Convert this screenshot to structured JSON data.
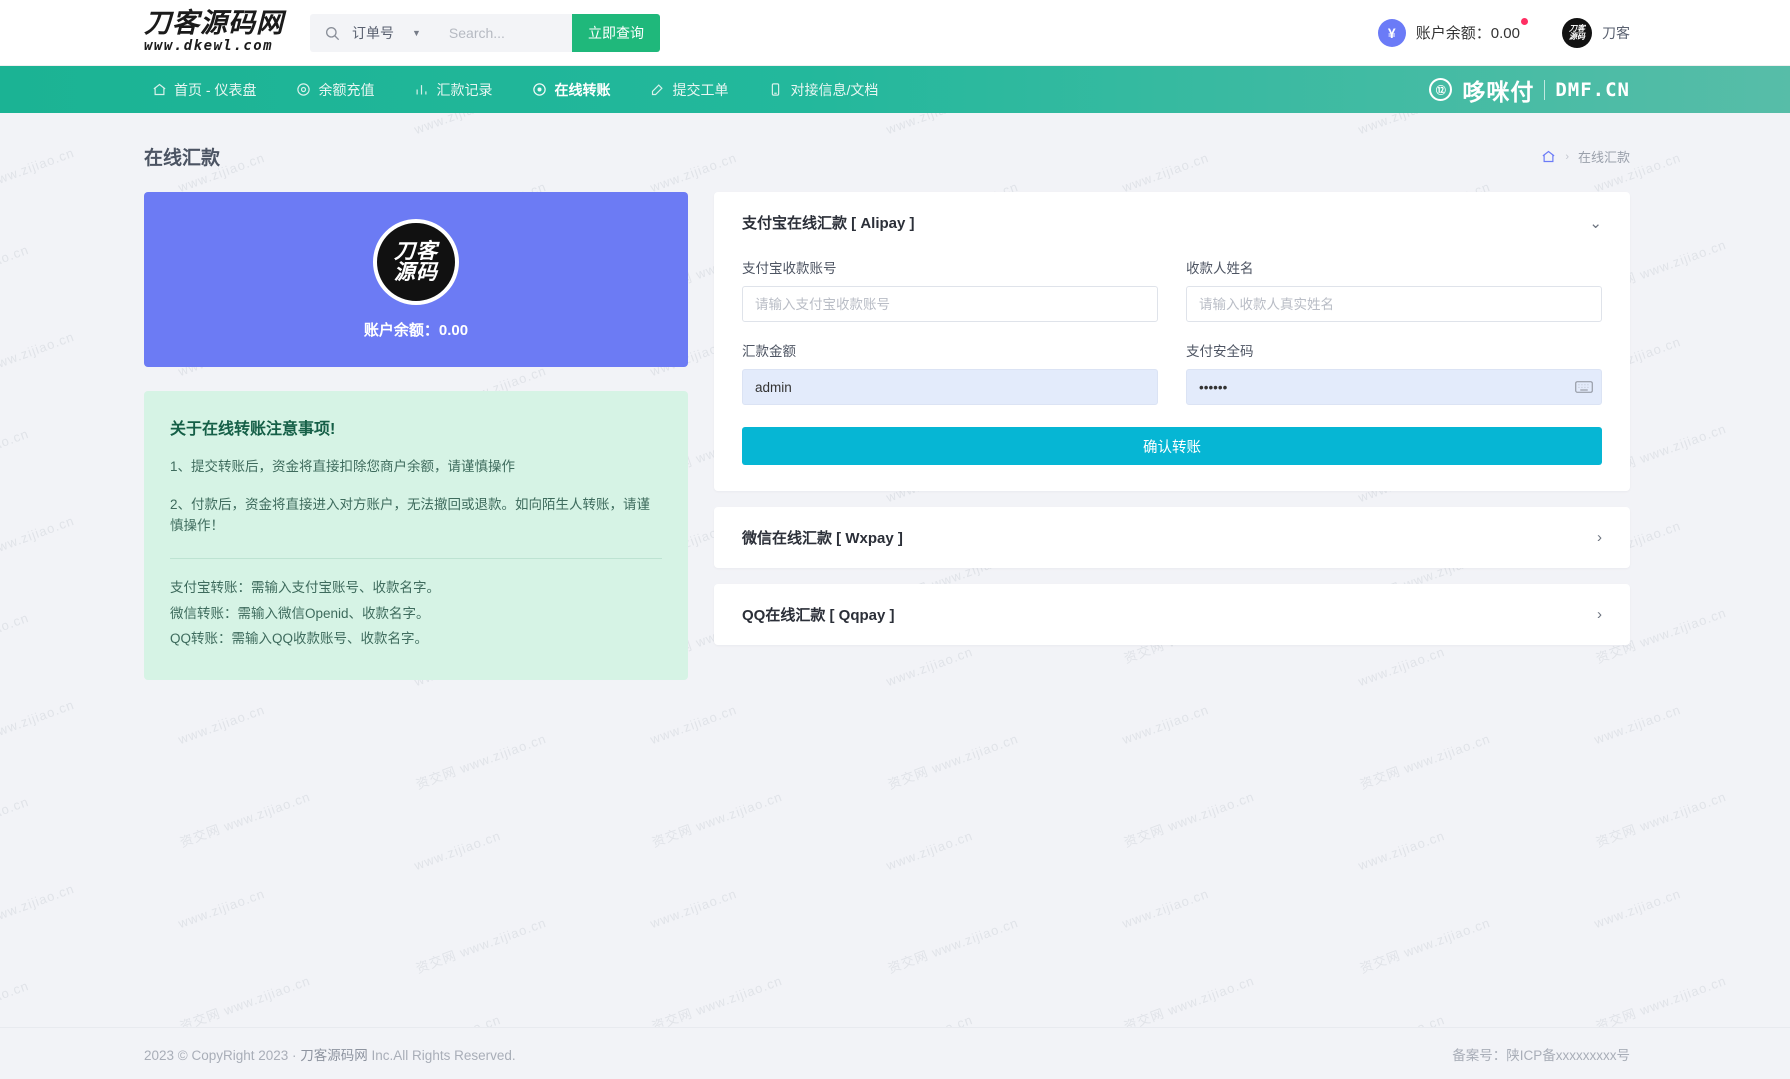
{
  "topbar": {
    "logo_main": "刀客源码网",
    "logo_sub": "www.dkewl.com",
    "search_category": "订单号",
    "search_placeholder": "Search...",
    "search_value": "",
    "search_button": "立即查询",
    "balance_label": "账户余额：0.00",
    "avatar_text": "刀客源码",
    "user_name": "刀客"
  },
  "nav": {
    "items": [
      {
        "label": "首页 - 仪表盘",
        "icon": "home-icon",
        "active": false
      },
      {
        "label": "余额充值",
        "icon": "coin-icon",
        "active": false
      },
      {
        "label": "汇款记录",
        "icon": "chart-icon",
        "active": false
      },
      {
        "label": "在线转账",
        "icon": "transfer-icon",
        "active": true
      },
      {
        "label": "提交工单",
        "icon": "edit-icon",
        "active": false
      },
      {
        "label": "对接信息/文档",
        "icon": "doc-icon",
        "active": false
      }
    ],
    "brand_cn": "哆咪付",
    "brand_en": "DMF.CN"
  },
  "header": {
    "page_title": "在线汇款",
    "breadcrumb_home_icon": "home-icon",
    "breadcrumb_separator": "›",
    "breadcrumb_current": "在线汇款"
  },
  "balance_card": {
    "logo_line1": "刀客",
    "logo_line2": "源码",
    "balance_text": "账户余额：0.00"
  },
  "notice": {
    "title": "关于在线转账注意事项!",
    "item1": "1、提交转账后，资金将直接扣除您商户余额，请谨慎操作",
    "item2": "2、付款后，资金将直接进入对方账户，无法撤回或退款。如向陌生人转账，请谨慎操作！",
    "sub1": "支付宝转账：需输入支付宝账号、收款名字。",
    "sub2": "微信转账：需输入微信Openid、收款名字。",
    "sub3": "QQ转账：需输入QQ收款账号、收款名字。"
  },
  "alipay_panel": {
    "title": "支付宝在线汇款 [ Alipay ]",
    "chevron": "⌄",
    "fields": {
      "account_label": "支付宝收款账号",
      "account_placeholder": "请输入支付宝收款账号",
      "account_value": "",
      "name_label": "收款人姓名",
      "name_placeholder": "请输入收款人真实姓名",
      "name_value": "",
      "amount_label": "汇款金额",
      "amount_value": "admin",
      "amount_placeholder": "",
      "paycode_label": "支付安全码",
      "paycode_value": "••••••",
      "paycode_placeholder": ""
    },
    "submit_label": "确认转账"
  },
  "wxpay_panel": {
    "title": "微信在线汇款 [ Wxpay ]",
    "chevron": "›"
  },
  "qqpay_panel": {
    "title": "QQ在线汇款 [ Qqpay ]",
    "chevron": "›"
  },
  "footer": {
    "copyright_pre": "2023 © CopyRight 2023 · ",
    "copyright_brand": "刀客源码网",
    "copyright_post": " Inc.All Rights Reserved.",
    "icp": "备案号：陕ICP备xxxxxxxxx号"
  },
  "colors": {
    "nav_green": "#1bb394",
    "accent_blue": "#6c7bf4",
    "submit_cyan": "#06b6d4",
    "notice_green_bg": "#d6f3e5",
    "search_btn_green": "#1fb87b"
  },
  "watermarks": [
    "www.zijiao.cn",
    "资交网 www.zijiao.cn"
  ]
}
